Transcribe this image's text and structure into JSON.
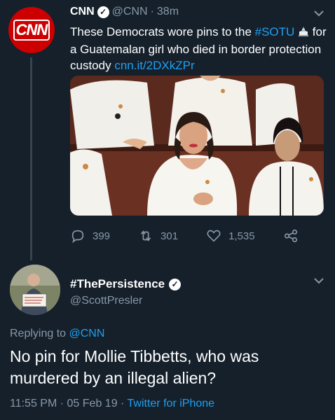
{
  "tweet": {
    "author_name": "CNN",
    "handle": "@CNN",
    "separator": "·",
    "time_ago": "38m",
    "text_main": "These Democrats wore pins to the ",
    "hashtag": "#SOTU",
    "text_rest": " for a Guatemalan girl who died in border protection custody ",
    "link": "cnn.it/2DXkZPr",
    "avatar_text": "CNN",
    "stats": {
      "replies": "399",
      "retweets": "301",
      "likes": "1,535"
    }
  },
  "reply": {
    "author_name": "#ThePersistence",
    "handle": "@ScottPresler",
    "replying_prefix": "Replying to ",
    "replying_to": "@CNN",
    "text": "No pin for Mollie Tibbetts, who was murdered by an illegal alien?",
    "time": "11:55 PM",
    "date": "05 Feb 19",
    "separator": "·",
    "source": "Twitter for iPhone"
  },
  "icons": [
    "verified-icon",
    "chevron-down-icon",
    "capitol-emoji-icon",
    "reply-icon",
    "retweet-icon",
    "like-icon",
    "share-icon"
  ],
  "colors": {
    "background": "#15202b",
    "link": "#1da1f2",
    "muted": "#8899a6",
    "cnn_red": "#cc0000"
  }
}
